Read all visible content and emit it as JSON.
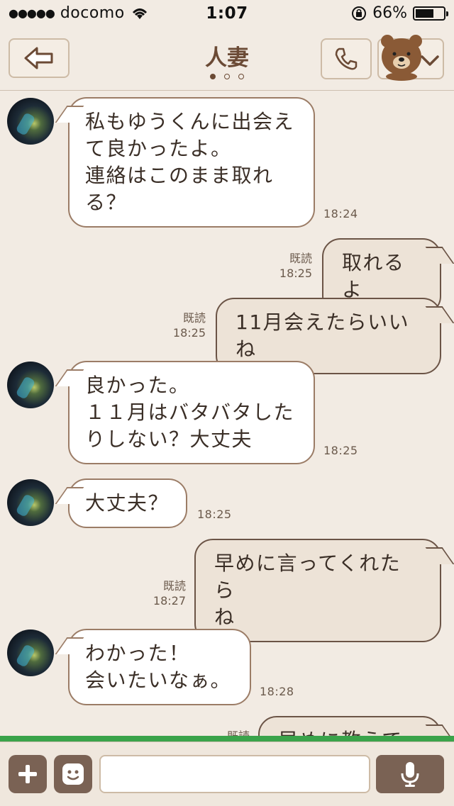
{
  "status_bar": {
    "carrier": "docomo",
    "time": "1:07",
    "battery": "66%",
    "battery_level": 0.66
  },
  "header": {
    "title": "人妻",
    "page_count": 3,
    "active_page": 0
  },
  "messages": [
    {
      "side": "in",
      "text": "私もゆうくんに出会え\nて良かったよ。\n連絡はこのまま取れ\nる？",
      "time": "18:24"
    },
    {
      "side": "out",
      "text": "取れるよ",
      "read": "既読",
      "time": "18:25"
    },
    {
      "side": "out",
      "text": "11月会えたらいいね",
      "read": "既読",
      "time": "18:25"
    },
    {
      "side": "in",
      "text": "良かった。\n１１月はバタバタした\nりしない？大丈夫",
      "time": "18:25"
    },
    {
      "side": "in",
      "text": "大丈夫？",
      "time": "18:25"
    },
    {
      "side": "out",
      "text": "早めに言ってくれたら\nね",
      "read": "既読",
      "time": "18:27"
    },
    {
      "side": "in",
      "text": "わかった！\n会いたいなぁ。",
      "time": "18:28"
    },
    {
      "side": "out",
      "text": "早めに教えてね",
      "read": "既読",
      "time": ""
    }
  ],
  "composer": {
    "text": ""
  }
}
